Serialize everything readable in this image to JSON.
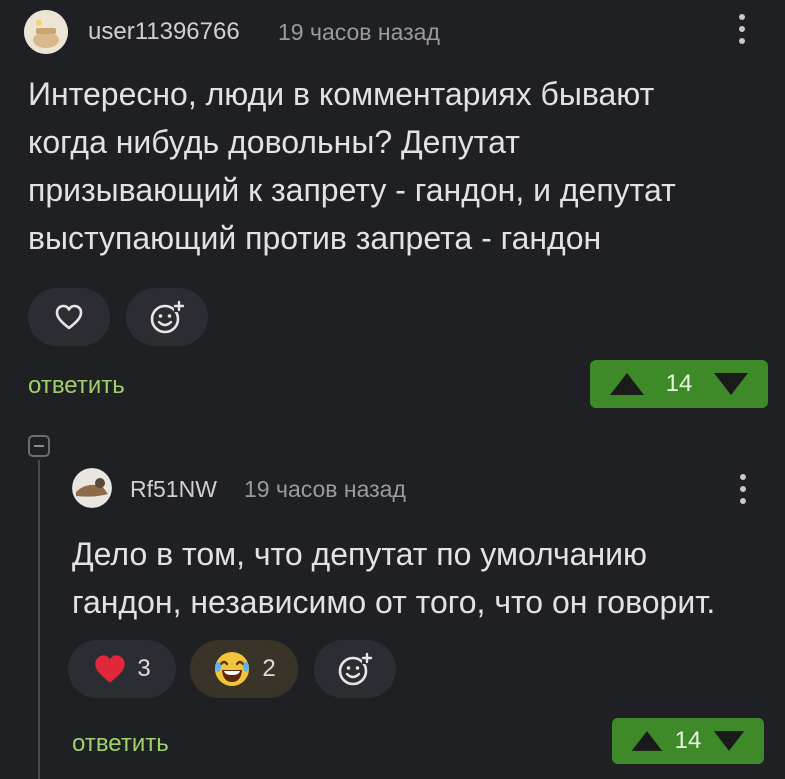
{
  "comment1": {
    "username": "user11396766",
    "time": "19 часов назад",
    "text_lines": [
      "Интересно, люди в комментариях бывают",
      "когда нибудь довольны? Депутат",
      "призывающий к запрету - гандон, и депутат",
      "выступающий против запрета - гандон"
    ],
    "reply_label": "ответить",
    "rating": "14"
  },
  "comment2": {
    "username": "Rf51NW",
    "time": "19 часов назад",
    "text_lines": [
      "Дело в том, что депутат по умолчанию",
      "гандон, независимо от того, что он говорит."
    ],
    "reactions": {
      "heart_count": "3",
      "laugh_count": "2"
    },
    "reply_label": "ответить",
    "rating": "14"
  },
  "icons": {
    "heart": "heart-icon",
    "add_reaction": "add-reaction-icon",
    "laugh": "laugh-emoji-icon",
    "upvote": "upvote-icon",
    "downvote": "downvote-icon",
    "more": "more-icon",
    "collapse": "collapse-icon"
  },
  "colors": {
    "background": "#1f2024",
    "accent_green": "#9fd16a",
    "vote_highlight": "#3f8a28",
    "heart_red": "#e0283a"
  }
}
